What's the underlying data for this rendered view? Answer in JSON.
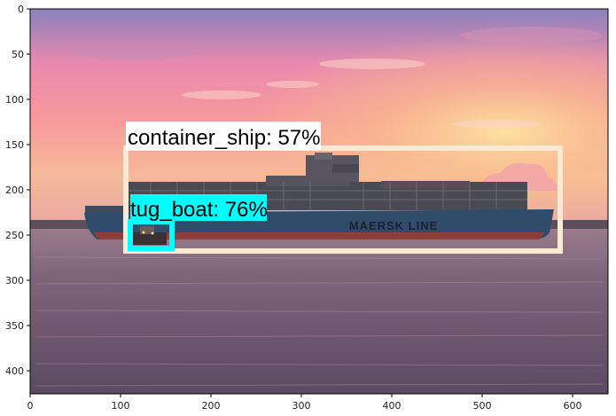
{
  "figure": {
    "x_ticks": [
      "0",
      "100",
      "200",
      "300",
      "400",
      "500",
      "600"
    ],
    "y_ticks": [
      "0",
      "50",
      "100",
      "150",
      "200",
      "250",
      "300",
      "350",
      "400"
    ]
  },
  "scene": {
    "description_colors": {
      "sky_top": "#7d7fb6",
      "sky_pink": "#f58aa2",
      "sky_glow": "#f9c98a",
      "water": "#6a5673",
      "hull": "#2f4f6b",
      "hull_bottom": "#a4493c",
      "containers": "#4a4a52"
    },
    "hull_text": "MAERSK LINE"
  },
  "detections": [
    {
      "label": "container_ship: 57%",
      "box_color": "#fbe9d4",
      "label_bg": "#ffffff"
    },
    {
      "label": "tug_boat: 76%",
      "box_color": "#00ffff",
      "label_bg": "#00ffff"
    }
  ]
}
